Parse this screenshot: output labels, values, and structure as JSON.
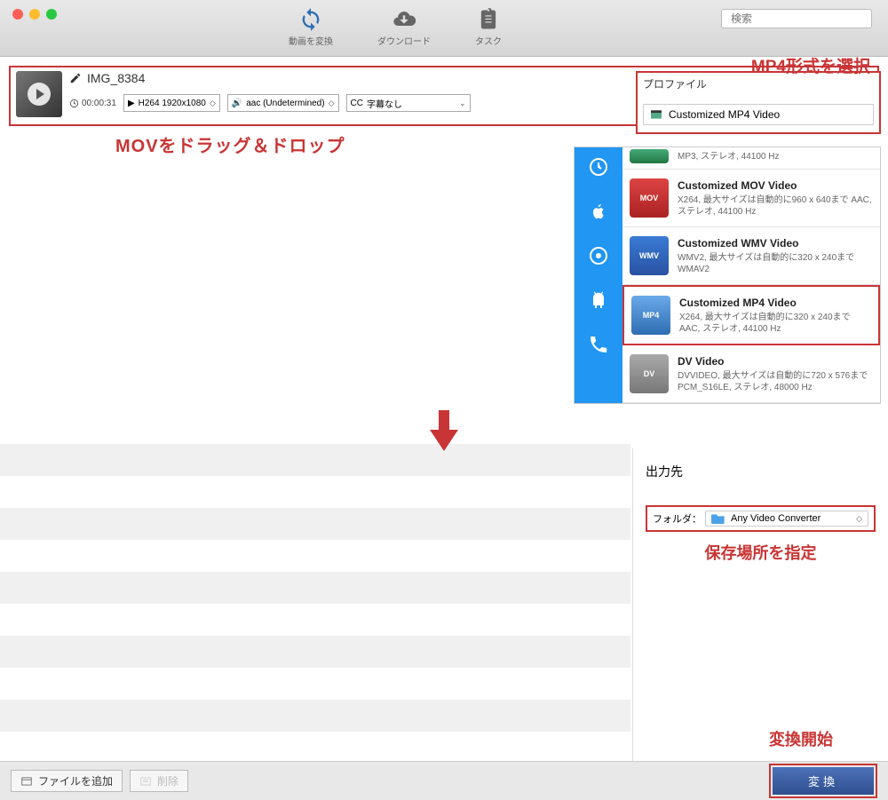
{
  "toolbar": {
    "convert_label": "動画を変換",
    "download_label": "ダウンロード",
    "task_label": "タスク",
    "search_placeholder": "検索"
  },
  "file": {
    "name": "IMG_8384",
    "duration": "00:00:31",
    "video_codec": "H264 1920x1080",
    "audio_codec": "aac (Undetermined)",
    "subtitle": "字幕なし"
  },
  "annotations": {
    "drag_drop": "MOVをドラッグ＆ドロップ",
    "select_mp4": "MP4形式を選択",
    "specify_location": "保存場所を指定",
    "start_convert": "変換開始"
  },
  "profile": {
    "label": "プロファイル",
    "selected": "Customized MP4 Video"
  },
  "format_list": {
    "truncated_top": "MP3, ステレオ, 44100 Hz",
    "items": [
      {
        "title": "Customized MOV Video",
        "desc": "X264, 最大サイズは自動的に960 x 640まで AAC, ステレオ, 44100 Hz",
        "tag": "MOV",
        "color1": "#d44",
        "color2": "#a22"
      },
      {
        "title": "Customized WMV Video",
        "desc": "WMV2, 最大サイズは自動的に320 x 240まで WMAV2",
        "tag": "WMV",
        "color1": "#3a7bd5",
        "color2": "#2952a3"
      },
      {
        "title": "Customized MP4 Video",
        "desc": "X264, 最大サイズは自動的に320 x 240まで AAC, ステレオ, 44100 Hz",
        "tag": "MP4",
        "color1": "#6aa9e9",
        "color2": "#2f6db3",
        "selected": true
      },
      {
        "title": "DV Video",
        "desc": "DVVIDEO, 最大サイズは自動的に720 x 576まで PCM_S16LE, ステレオ, 48000 Hz",
        "tag": "DV",
        "color1": "#aaa",
        "color2": "#777"
      }
    ]
  },
  "output": {
    "title": "出力先",
    "folder_label": "フォルダ：",
    "folder_value": "Any Video Converter"
  },
  "bottom": {
    "add_file": "ファイルを追加",
    "delete": "削除",
    "convert": "変換"
  }
}
